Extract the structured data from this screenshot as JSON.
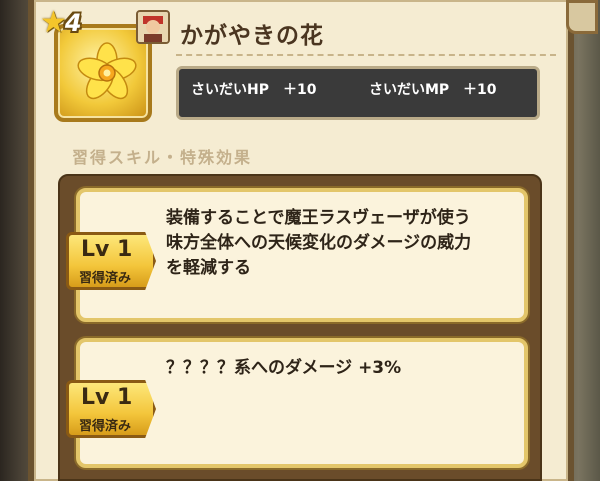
{
  "item": {
    "rarity": "4",
    "name": "かがやきの花"
  },
  "stats": [
    {
      "label": "さいだいHP",
      "value": "＋10"
    },
    {
      "label": "さいだいMP",
      "value": "＋10"
    }
  ],
  "section_title": "習得スキル・特殊効果",
  "skills": [
    {
      "level": "Lv 1",
      "status": "習得済み",
      "lines": [
        "装備することで魔王ラスヴェーザが使う",
        "味方全体への天候変化のダメージの威力",
        "を軽減する"
      ]
    },
    {
      "level": "Lv 1",
      "status": "習得済み",
      "lines": [
        "？？？？系へのダメージ +3%"
      ]
    }
  ],
  "colors": {
    "panel": "#f5ecd2",
    "gold": "#f2c93a",
    "stats_bg": "#3a3a3a",
    "skill_area": "#6a4c2a"
  }
}
